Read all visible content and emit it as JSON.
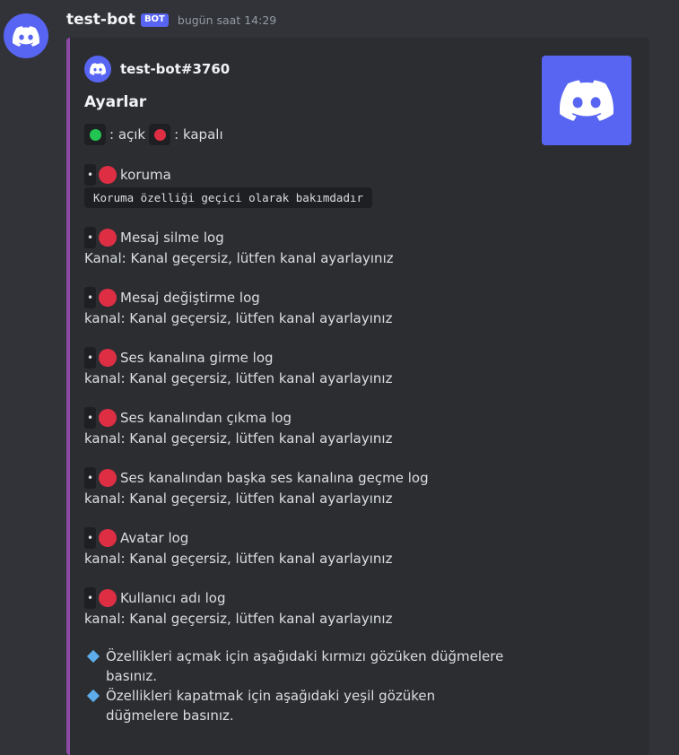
{
  "message": {
    "username": "test-bot",
    "bot_tag": "BOT",
    "timestamp": "bugün saat 14:29"
  },
  "embed": {
    "author": "test-bot#3760",
    "title": "Ayarlar",
    "accent_color": "#8c49a6",
    "legend": {
      "on_label": ": açık",
      "off_label": ": kapalı"
    },
    "features": [
      {
        "name": "koruma",
        "status": "kapalı",
        "code": "Koruma özelliği geçici olarak bakımdadır"
      },
      {
        "name": "Mesaj silme log",
        "status": "kapalı",
        "detail": "Kanal: Kanal geçersiz, lütfen kanal ayarlayınız"
      },
      {
        "name": "Mesaj değiştirme log",
        "status": "kapalı",
        "detail": "kanal: Kanal geçersiz, lütfen kanal ayarlayınız"
      },
      {
        "name": "Ses kanalına girme log",
        "status": "kapalı",
        "detail": "kanal: Kanal geçersiz, lütfen kanal ayarlayınız"
      },
      {
        "name": "Ses kanalından çıkma log",
        "status": "kapalı",
        "detail": "kanal: Kanal geçersiz, lütfen kanal ayarlayınız"
      },
      {
        "name": "Ses kanalından başka ses kanalına geçme log",
        "status": "kapalı",
        "detail": "kanal: Kanal geçersiz, lütfen kanal ayarlayınız"
      },
      {
        "name": "Avatar log",
        "status": "kapalı",
        "detail": "kanal: Kanal geçersiz, lütfen kanal ayarlayınız"
      },
      {
        "name": "Kullanıcı adı log",
        "status": "kapalı",
        "detail": "kanal: Kanal geçersiz, lütfen kanal ayarlayınız"
      }
    ],
    "bullet": "•",
    "notes": [
      "Özellikleri açmak için aşağıdaki kırmızı gözüken düğmelere basınız.",
      "Özellikleri kapatmak için aşağıdaki yeşil gözüken düğmelere basınız."
    ]
  },
  "colors": {
    "on": "#23c552",
    "off": "#dd2e44",
    "blurple": "#5865f2"
  }
}
